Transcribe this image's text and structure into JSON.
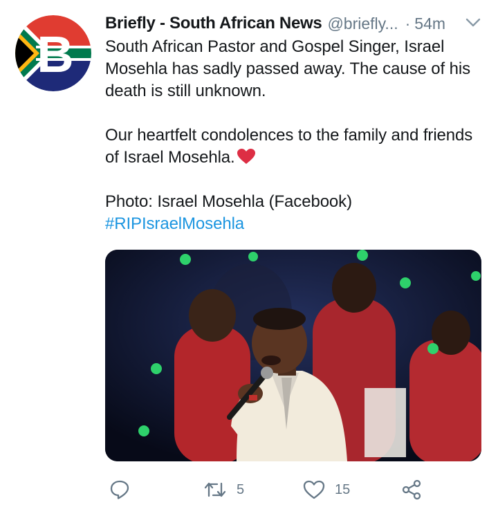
{
  "tweet": {
    "author_name": "Briefly - South African News",
    "handle": "@briefly...",
    "separator": "·",
    "time": "54m",
    "text_line1": "South African Pastor and Gospel Singer, Israel Mosehla has sadly passed away. The cause of his death is still unknown.",
    "text_line2": "Our heartfelt condolences to the family and friends of Israel  Mosehla.",
    "text_line3": "Photo: Israel Mosehla (Facebook)",
    "hashtag": "#RIPIsraelMosehla",
    "avatar_letter": "B"
  },
  "actions": {
    "reply_icon": "reply-icon",
    "retweet_count": "5",
    "like_count": "15",
    "share_icon": "share-icon"
  },
  "colors": {
    "handle_gray": "#657786",
    "link_blue": "#1b95e0",
    "heart_red": "#e0245e"
  }
}
